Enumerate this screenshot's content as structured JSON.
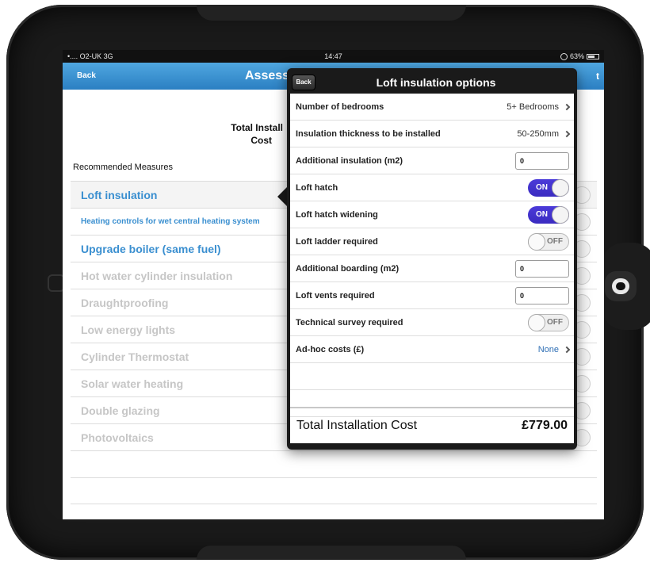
{
  "status": {
    "carrier": "•.... O2-UK  3G",
    "time": "14:47",
    "battery": "63%"
  },
  "nav": {
    "back": "Back",
    "title": "Assess",
    "right_fragment": "t"
  },
  "header": {
    "col_title": "Total Install Cost",
    "col_title_line1": "Total Install",
    "col_title_line2": "Cost"
  },
  "recommended_label": "Recommended Measures",
  "measures": [
    {
      "label": "Loft insulation",
      "active": true
    },
    {
      "label": "Heating controls for wet central heating system",
      "active": true
    },
    {
      "label": "Upgrade boiler (same fuel)",
      "active": true
    },
    {
      "label": "Hot water cylinder insulation",
      "active": false
    },
    {
      "label": "Draughtproofing",
      "active": false
    },
    {
      "label": "Low energy lights",
      "active": false
    },
    {
      "label": "Cylinder Thermostat",
      "active": false
    },
    {
      "label": "Solar water heating",
      "active": false
    },
    {
      "label": "Double glazing",
      "active": false
    },
    {
      "label": "Photovoltaics",
      "active": false
    }
  ],
  "popover": {
    "back": "Back",
    "title": "Loft insulation options",
    "options": [
      {
        "label": "Number of bedrooms",
        "type": "select",
        "value": "5+ Bedrooms"
      },
      {
        "label": "Insulation thickness to be installed",
        "type": "select",
        "value": "50-250mm"
      },
      {
        "label": "Additional insulation (m2)",
        "type": "input",
        "value": "0"
      },
      {
        "label": "Loft hatch",
        "type": "toggle",
        "value": "ON"
      },
      {
        "label": "Loft hatch widening",
        "type": "toggle",
        "value": "ON"
      },
      {
        "label": "Loft ladder required",
        "type": "toggle",
        "value": "OFF"
      },
      {
        "label": "Additional boarding (m2)",
        "type": "input",
        "value": "0"
      },
      {
        "label": "Loft vents required",
        "type": "input",
        "value": "0"
      },
      {
        "label": "Technical survey required",
        "type": "toggle",
        "value": "OFF"
      },
      {
        "label": "Ad-hoc costs (£)",
        "type": "select",
        "value": "None"
      }
    ],
    "total_label": "Total Installation Cost",
    "total_value": "£779.00"
  },
  "colors": {
    "nav_blue": "#2b7fc2",
    "active_text": "#3a8fd0",
    "toggle_on": "#4b3ad9",
    "inactive_text": "#c6c6c6"
  }
}
